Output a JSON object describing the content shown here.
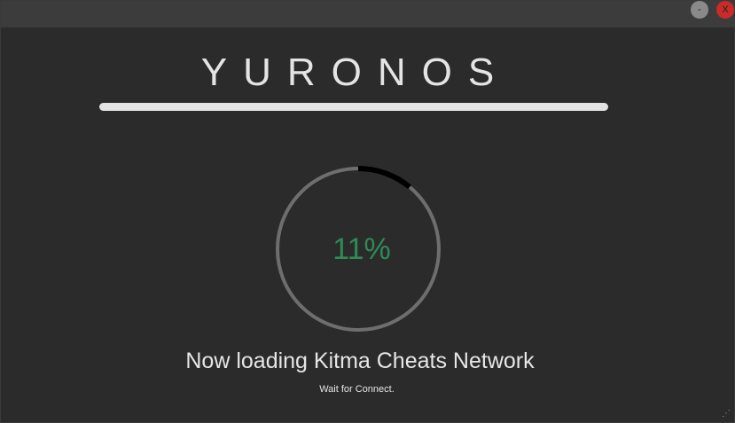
{
  "titlebar": {
    "minimize_label": "-",
    "close_label": "X"
  },
  "brand": {
    "name": "YURONOS"
  },
  "progress": {
    "percent": 11,
    "label": "11%",
    "track_color": "#6e6e6e",
    "fill_color": "#000000",
    "text_color": "#2e8b57"
  },
  "status": {
    "headline": "Now loading Kitma Cheats Network",
    "subtext": "Wait for Connect."
  },
  "resize_grip_icon": "resize-grip-icon"
}
